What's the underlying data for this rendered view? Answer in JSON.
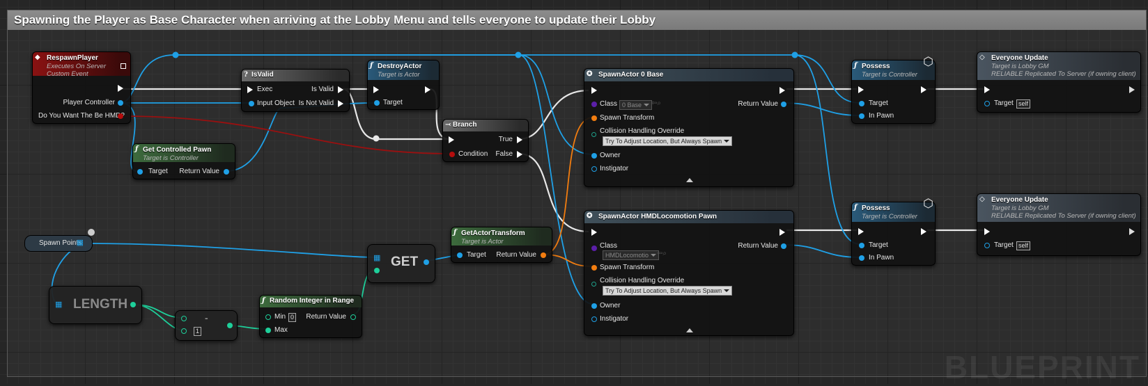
{
  "comment": {
    "title": "Spawning the Player as Base Character when arriving at the Lobby Menu and tells everyone to update their Lobby"
  },
  "watermark": "BLUEPRINT",
  "colors": {
    "exec": "#ffffff",
    "object": "#1fa0e6",
    "bool": "#b40d0d",
    "transform": "#f27d10",
    "int": "#1ecf9a",
    "class": "#5b1fa8"
  },
  "nodes": {
    "respawn": {
      "title": "RespawnPlayer",
      "sub1": "Executes On Server",
      "sub2": "Custom Event",
      "pins": {
        "player_controller": "Player Controller",
        "hmd": "Do You Want The Be HMD?"
      }
    },
    "isvalid": {
      "icon": "?",
      "title": "IsValid",
      "pins": {
        "exec": "Exec",
        "is_valid": "Is Valid",
        "input_object": "Input Object",
        "is_not_valid": "Is Not Valid"
      }
    },
    "destroy": {
      "icon": "f",
      "title": "DestroyActor",
      "sub": "Target is Actor",
      "pins": {
        "target": "Target"
      }
    },
    "branch": {
      "title": "Branch",
      "pins": {
        "condition": "Condition",
        "true": "True",
        "false": "False"
      }
    },
    "getpawn": {
      "icon": "f",
      "title": "Get Controlled Pawn",
      "sub": "Target is Controller",
      "pins": {
        "target": "Target",
        "return": "Return Value"
      }
    },
    "spawn_base": {
      "title": "SpawnActor 0 Base",
      "pins": {
        "class": "Class",
        "class_value": "0 Base",
        "return": "Return Value",
        "spawn_transform": "Spawn Transform",
        "collision": "Collision Handling Override",
        "collision_value": "Try To Adjust Location, But Always Spawn",
        "owner": "Owner",
        "instigator": "Instigator"
      }
    },
    "spawn_hmd": {
      "title": "SpawnActor HMDLocomotion Pawn",
      "pins": {
        "class": "Class",
        "class_value": "HMDLocomotio",
        "return": "Return Value",
        "spawn_transform": "Spawn Transform",
        "collision": "Collision Handling Override",
        "collision_value": "Try To Adjust Location, But Always Spawn",
        "owner": "Owner",
        "instigator": "Instigator"
      }
    },
    "possess1": {
      "icon": "f",
      "title": "Possess",
      "sub": "Target is Controller",
      "pins": {
        "target": "Target",
        "in_pawn": "In Pawn"
      }
    },
    "possess2": {
      "icon": "f",
      "title": "Possess",
      "sub": "Target is Controller",
      "pins": {
        "target": "Target",
        "in_pawn": "In Pawn"
      }
    },
    "update1": {
      "title": "Everyone Update",
      "sub1": "Target is Lobby GM",
      "sub2": "RELIABLE Replicated To Server (if owning client)",
      "pins": {
        "target": "Target",
        "target_value": "self"
      }
    },
    "update2": {
      "title": "Everyone Update",
      "sub1": "Target is Lobby GM",
      "sub2": "RELIABLE Replicated To Server (if owning client)",
      "pins": {
        "target": "Target",
        "target_value": "self"
      }
    },
    "spawnpoints": {
      "label": "Spawn Points"
    },
    "length": {
      "label": "LENGTH"
    },
    "get": {
      "label": "GET"
    },
    "subtract": {
      "label": "-",
      "value": "1"
    },
    "random": {
      "icon": "f",
      "title": "Random Integer in Range",
      "pins": {
        "min": "Min",
        "min_value": "0",
        "return": "Return Value",
        "max": "Max"
      }
    },
    "transform": {
      "icon": "f",
      "title": "GetActorTransform",
      "sub": "Target is Actor",
      "pins": {
        "target": "Target",
        "return": "Return Value"
      }
    }
  }
}
